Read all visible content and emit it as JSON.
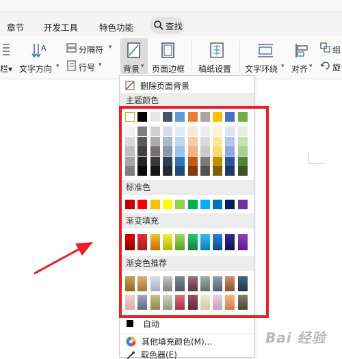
{
  "tabs": [
    {
      "label": "章节"
    },
    {
      "label": "开发工具"
    },
    {
      "label": "特色功能"
    }
  ],
  "search": {
    "label": "查找"
  },
  "ribbon": {
    "columns_partial": "栏▾",
    "text_direction": "文字方向",
    "separator": "分隔符",
    "line_number": "行号",
    "background": "背景",
    "page_border": "页面边框",
    "grid_paper": "稿纸设置",
    "text_wrap": "文字环绕",
    "align": "对齐",
    "group_partial": "组",
    "rotate_partial": "旋"
  },
  "menu": {
    "delete_bg": "删除页面背景",
    "theme_colors_heading": "主题颜色",
    "standard_heading": "标准色",
    "gradient_heading": "渐变填充",
    "gradient_recommend_heading": "渐变色推荐",
    "auto": "自动",
    "more_colors": "其他填充颜色(M)...",
    "eyedropper": "取色器(E)"
  },
  "colors": {
    "theme_row": [
      "#ffffff",
      "#000000",
      "#e7e6e6",
      "#44546a",
      "#5b9bd5",
      "#ed7d31",
      "#a5a5a5",
      "#ffc000",
      "#4472c4",
      "#70ad47"
    ],
    "theme_shades": [
      [
        "#f2f2f2",
        "#7f7f7f",
        "#d0cece",
        "#d6dce4",
        "#deebf6",
        "#fbe5d5",
        "#ededed",
        "#fff2cc",
        "#dae3f3",
        "#e2efd9"
      ],
      [
        "#d8d8d8",
        "#595959",
        "#aeabab",
        "#adb9ca",
        "#bdd7ee",
        "#f7cbac",
        "#dbdbdb",
        "#fee599",
        "#b4c6e7",
        "#c5e0b3"
      ],
      [
        "#bfbfbf",
        "#3f3f3f",
        "#757070",
        "#8496b0",
        "#9cc3e5",
        "#f4b183",
        "#c9c9c9",
        "#ffd965",
        "#8eaadb",
        "#a8d08d"
      ],
      [
        "#a5a5a5",
        "#262626",
        "#3a3838",
        "#323f4f",
        "#2e75b5",
        "#c55a11",
        "#7b7b7b",
        "#bf9000",
        "#2f5496",
        "#538135"
      ],
      [
        "#7f7f7f",
        "#0c0c0c",
        "#171616",
        "#222a35",
        "#1e4e79",
        "#833c0b",
        "#525252",
        "#7f6000",
        "#1f3864",
        "#375623"
      ]
    ],
    "standard": [
      "#c00000",
      "#ff0000",
      "#ffc000",
      "#ffff00",
      "#92d050",
      "#00b050",
      "#00b0f0",
      "#0070c0",
      "#002060",
      "#7030a0"
    ],
    "gradient": [
      [
        "#e00000",
        "#900000"
      ],
      [
        "#e83030",
        "#a02020"
      ],
      [
        "#f4c040",
        "#c07000"
      ],
      [
        "#f0f040",
        "#b0b000"
      ],
      [
        "#a0d860",
        "#60a020"
      ],
      [
        "#30c870",
        "#10803c"
      ],
      [
        "#30c0f0",
        "#0080c0"
      ],
      [
        "#3080d8",
        "#104890"
      ],
      [
        "#303090",
        "#101050"
      ],
      [
        "#9040c0",
        "#5a1890"
      ]
    ],
    "recommend_row1": [
      [
        "#c8a050",
        "#8a6a20"
      ],
      [
        "#e0b070",
        "#a07830"
      ],
      [
        "#d8e0e8",
        "#a0b0c0"
      ],
      [
        "#c8c8c8",
        "#808080"
      ],
      [
        "#808890",
        "#505860"
      ],
      [
        "#a07080",
        "#603048"
      ],
      [
        "#a0b0a8",
        "#607068"
      ],
      [
        "#90a0b0",
        "#506070"
      ],
      [
        "#d09070",
        "#905030"
      ],
      [
        "#406880",
        "#203040"
      ]
    ],
    "recommend_row2": [
      [
        "#f0d0d0",
        "#e0a8a8"
      ],
      [
        "#a0a8c0",
        "#606880"
      ],
      [
        "#c8c090",
        "#908850"
      ],
      [
        "#d0d8c8",
        "#909880"
      ],
      [
        "#e07080",
        "#a03048"
      ],
      [
        "#a05060",
        "#602838"
      ],
      [
        "#f0e8d0",
        "#d8c8a0"
      ],
      [
        "#e8d0e0",
        "#c8a0b8"
      ],
      [
        "#f0b880",
        "#d08040"
      ],
      [
        "#808070",
        "#484838"
      ]
    ],
    "highlight": "#e8202a"
  }
}
